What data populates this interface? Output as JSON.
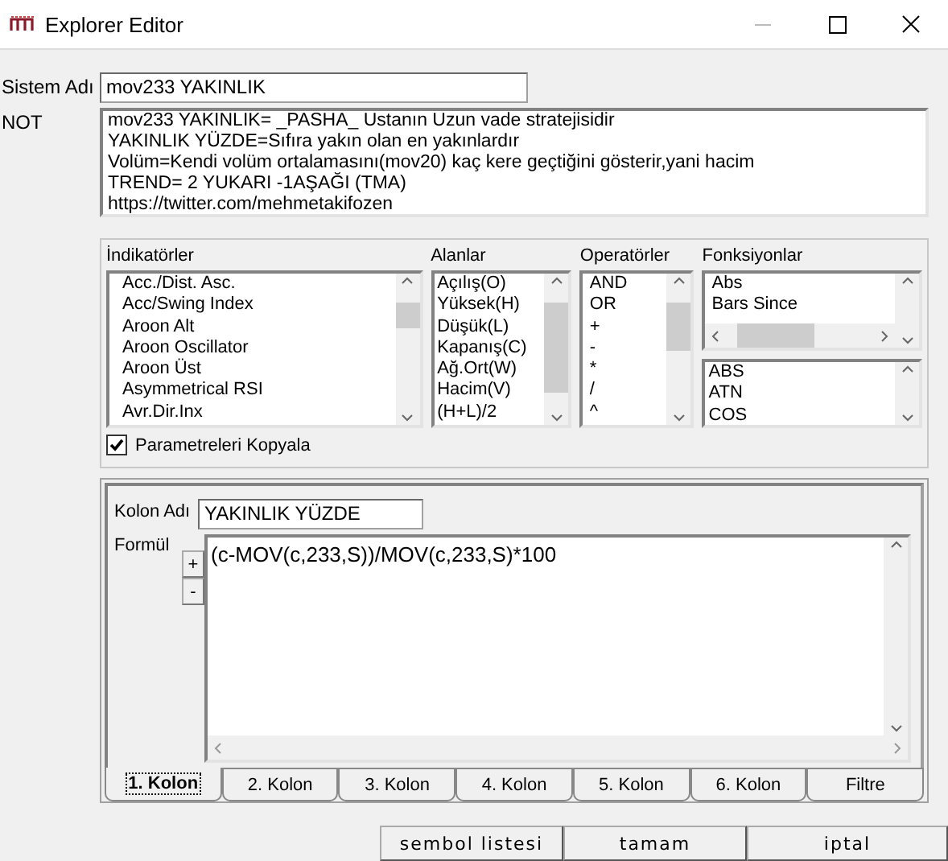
{
  "window": {
    "title": "Explorer Editor"
  },
  "system_name": {
    "label": "Sistem Adı",
    "value": "mov233 YAKINLIK"
  },
  "note": {
    "label": "NOT",
    "lines": [
      "mov233 YAKINLIK= _PASHA_ Ustanın Uzun vade stratejisidir",
      "YAKINLIK YÜZDE=Sıfıra yakın olan en yakınlardır",
      "Volüm=Kendi volüm ortalamasını(mov20) kaç kere geçtiğini gösterir,yani hacim",
      "TREND= 2 YUKARI -1AŞAĞI (TMA)",
      "https://twitter.com/mehmetakifozen"
    ]
  },
  "indicators": {
    "label": "İndikatörler",
    "items": [
      "Acc./Dist. Asc.",
      "Acc/Swing Index",
      "Aroon Alt",
      "Aroon Oscillator",
      "Aroon Üst",
      "Asymmetrical RSI",
      "Avr.Dir.Inx"
    ]
  },
  "fields": {
    "label": "Alanlar",
    "items": [
      "Açılış(O)",
      "Yüksek(H)",
      "Düşük(L)",
      "Kapanış(C)",
      "Ağ.Ort(W)",
      "Hacim(V)",
      "(H+L)/2"
    ]
  },
  "operators": {
    "label": "Operatörler",
    "items": [
      "AND",
      "OR",
      "+",
      "-",
      "*",
      "/",
      "^"
    ]
  },
  "functions": {
    "label": "Fonksiyonlar",
    "items": [
      "Abs",
      "Bars Since"
    ]
  },
  "function_codes": {
    "items": [
      "ABS",
      "ATN",
      "COS"
    ]
  },
  "copy_params": {
    "label": "Parametreleri Kopyala",
    "checked": true
  },
  "column_name": {
    "label": "Kolon Adı",
    "value": "YAKINLIK YÜZDE"
  },
  "formula": {
    "label": "Formül",
    "value": "(c-MOV(c,233,S))/MOV(c,233,S)*100",
    "buttons": [
      "+",
      "-"
    ]
  },
  "tabs": [
    {
      "label": "1. Kolon",
      "selected": true
    },
    {
      "label": "2. Kolon",
      "selected": false
    },
    {
      "label": "3. Kolon",
      "selected": false
    },
    {
      "label": "4. Kolon",
      "selected": false
    },
    {
      "label": "5. Kolon",
      "selected": false
    },
    {
      "label": "6. Kolon",
      "selected": false
    },
    {
      "label": "Filtre",
      "selected": false
    }
  ],
  "buttons": [
    "sembol listesi",
    "tamam",
    "iptal"
  ]
}
